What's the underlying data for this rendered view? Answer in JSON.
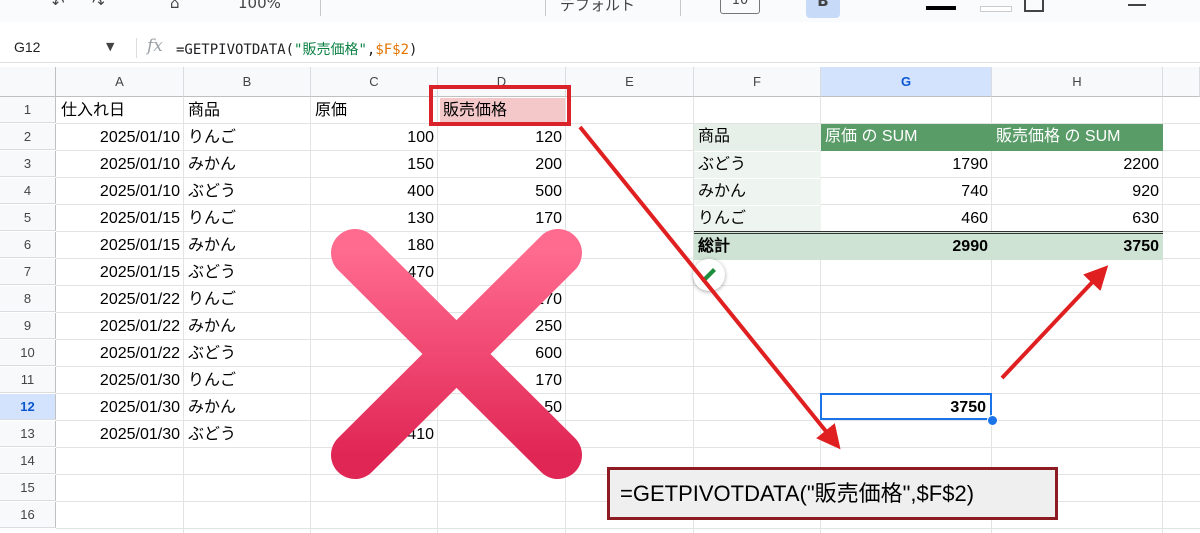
{
  "toolbar": {
    "zoom": "100%",
    "font": "デフォルト",
    "font_size": "10",
    "bold": "B",
    "undo": "↶",
    "redo": "↷",
    "paint": "⌂"
  },
  "formula_bar": {
    "cell_ref": "G12",
    "fx": "fx",
    "formula_prefix": "=GETPIVOTDATA(",
    "formula_string": "\"販売価格\"",
    "formula_comma": ",",
    "formula_ref": "$F$2",
    "formula_suffix": ")"
  },
  "columns": [
    "A",
    "B",
    "C",
    "D",
    "E",
    "F",
    "G",
    "H"
  ],
  "selected_column": "G",
  "rows": [
    "1",
    "2",
    "3",
    "4",
    "5",
    "6",
    "7",
    "8",
    "9",
    "10",
    "11",
    "12",
    "13",
    "14",
    "15",
    "16"
  ],
  "selected_row": "12",
  "headers": {
    "a": "仕入れ日",
    "b": "商品",
    "c": "原価",
    "d": "販売価格"
  },
  "data_rows": [
    {
      "date": "2025/01/10",
      "item": "りんご",
      "cost": "100",
      "price": "120"
    },
    {
      "date": "2025/01/10",
      "item": "みかん",
      "cost": "150",
      "price": "200"
    },
    {
      "date": "2025/01/10",
      "item": "ぶどう",
      "cost": "400",
      "price": "500"
    },
    {
      "date": "2025/01/15",
      "item": "りんご",
      "cost": "130",
      "price": "170"
    },
    {
      "date": "2025/01/15",
      "item": "みかん",
      "cost": "180",
      "price": ""
    },
    {
      "date": "2025/01/15",
      "item": "ぶどう",
      "cost": "470",
      "price": ""
    },
    {
      "date": "2025/01/22",
      "item": "りんご",
      "cost": "",
      "price": "170"
    },
    {
      "date": "2025/01/22",
      "item": "みかん",
      "cost": "",
      "price": "250"
    },
    {
      "date": "2025/01/22",
      "item": "ぶどう",
      "cost": "5",
      "price": "600"
    },
    {
      "date": "2025/01/30",
      "item": "りんご",
      "cost": "",
      "price": "170"
    },
    {
      "date": "2025/01/30",
      "item": "みかん",
      "cost": "",
      "price": "50"
    },
    {
      "date": "2025/01/30",
      "item": "ぶどう",
      "cost": "410",
      "price": ""
    }
  ],
  "pivot": {
    "header_item": "商品",
    "header_cost": "原価 の SUM",
    "header_price": "販売価格 の SUM",
    "rows": [
      {
        "item": "ぶどう",
        "cost": "1790",
        "price": "2200"
      },
      {
        "item": "みかん",
        "cost": "740",
        "price": "920"
      },
      {
        "item": "りんご",
        "cost": "460",
        "price": "630"
      }
    ],
    "total_label": "総計",
    "total_cost": "2990",
    "total_price": "3750"
  },
  "selected_cell_value": "3750",
  "callout_text": "=GETPIVOTDATA(\"販売価格\",$F$2)",
  "colors": {
    "highlight_border": "#d9222a",
    "highlight_fill": "#f4c7c9",
    "arrow": "#e02020",
    "cross": "#ef3f6d",
    "pivot_header": "#5a9c68",
    "pivot_total": "#cfe3d4",
    "selection": "#1a73e8",
    "callout_border": "#8c1c22"
  },
  "icons": {
    "pencil": "pencil-icon",
    "cross": "cross-mark-icon"
  }
}
